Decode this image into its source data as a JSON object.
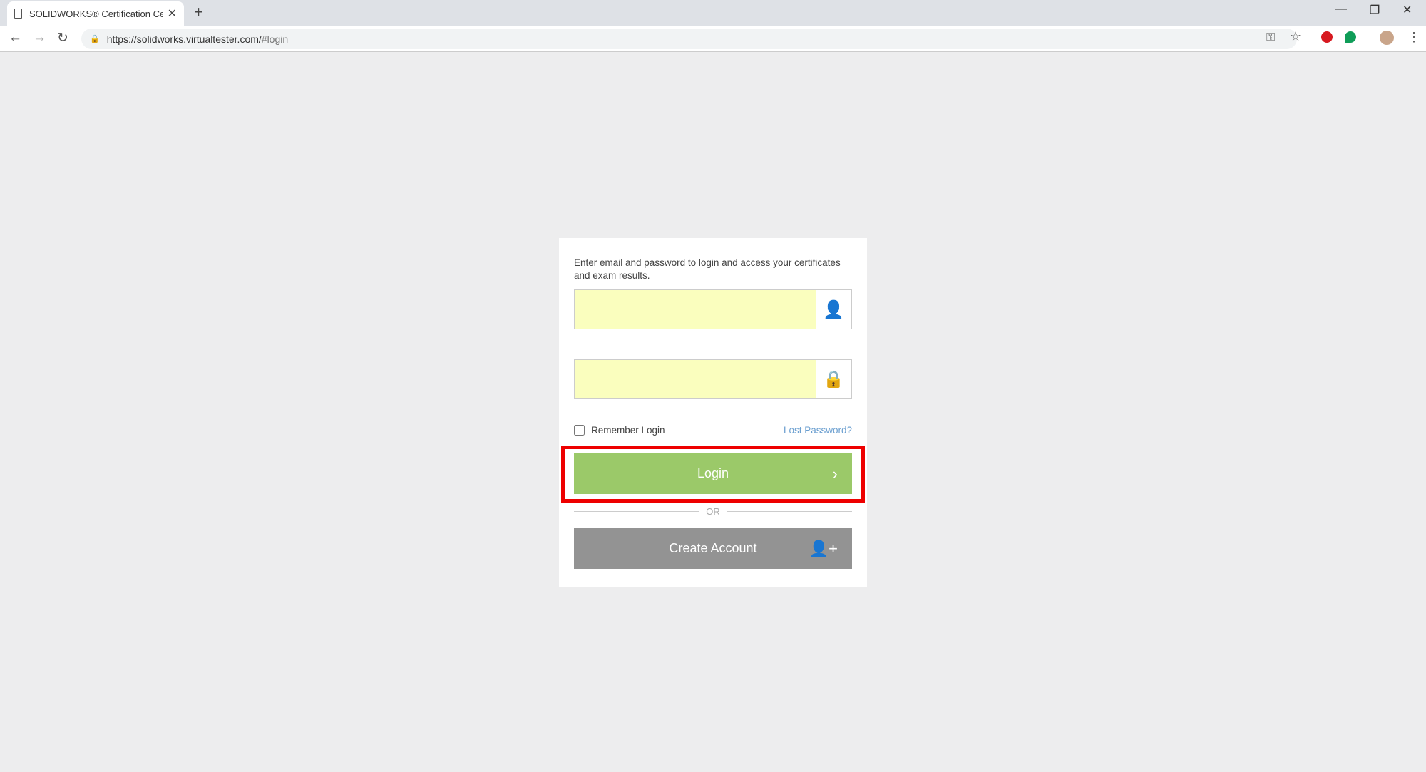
{
  "browser": {
    "tab_title": "SOLIDWORKS® Certification Cen",
    "url_host": "https://solidworks.virtualtester.com/",
    "url_path": "#login",
    "icons": [
      "page-icon",
      "close-icon",
      "new-tab-icon",
      "minimize-icon",
      "restore-icon",
      "window-close-icon",
      "back-icon",
      "forward-icon",
      "reload-icon",
      "lock-icon",
      "key-icon",
      "star-icon",
      "opera-extension-icon",
      "hangouts-extension-icon",
      "profile-avatar",
      "menu-icon"
    ]
  },
  "login": {
    "intro": "Enter email and password to login and access your certificates and exam results.",
    "email_value": "",
    "password_value": "",
    "remember_label": "Remember Login",
    "remember_checked": false,
    "lost_password": "Lost Password?",
    "login_label": "Login",
    "or_label": "OR",
    "create_label": "Create Account"
  },
  "colors": {
    "login_button": "#9bc969",
    "create_button": "#939393",
    "autofill": "#fafebe",
    "highlight": "#e00000",
    "link": "#6b9fd0"
  }
}
